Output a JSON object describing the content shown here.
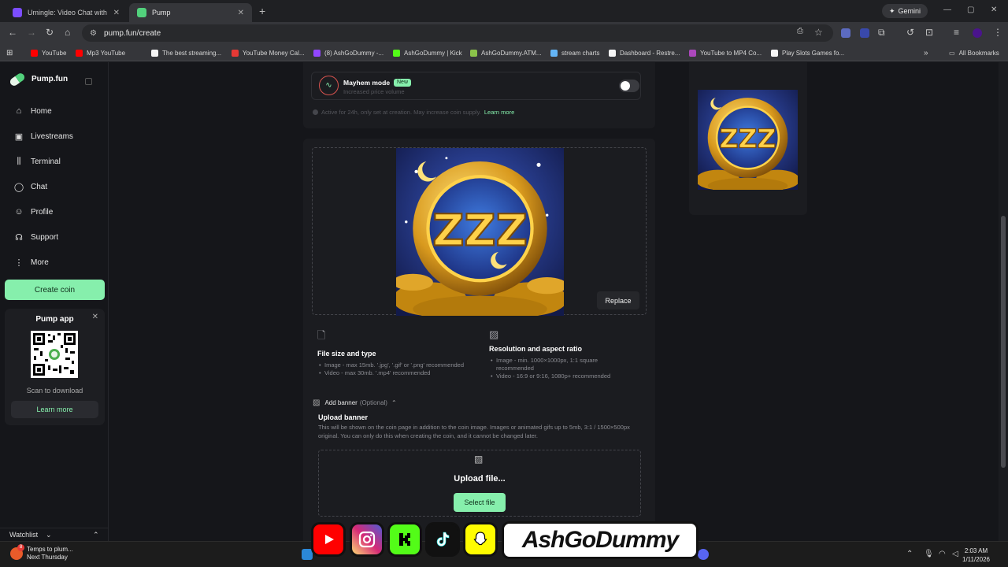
{
  "browser": {
    "tabs": [
      {
        "title": "Umingle: Video Chat with Stra",
        "favicon_color": "#7c4dff"
      },
      {
        "title": "Pump",
        "favicon_color": "#52d17c"
      }
    ],
    "gemini_label": "Gemini",
    "url": "pump.fun/create",
    "bookmarks": [
      {
        "label": "YouTube",
        "color": "#ff0000"
      },
      {
        "label": "Mp3 YouTube",
        "color": "#ff0000"
      },
      {
        "label": "The best streaming...",
        "color": "#f5f5f5"
      },
      {
        "label": "YouTube Money Cal...",
        "color": "#e53935"
      },
      {
        "label": "(8) AshGoDummy -...",
        "color": "#9146ff"
      },
      {
        "label": "AshGoDummy | Kick",
        "color": "#53fc18"
      },
      {
        "label": "AshGoDummy.ATM...",
        "color": "#8bc34a"
      },
      {
        "label": "stream charts",
        "color": "#64b5f6"
      },
      {
        "label": "Dashboard - Restre...",
        "color": "#f5f5f5"
      },
      {
        "label": "YouTube to MP4 Co...",
        "color": "#ab47bc"
      },
      {
        "label": "Play Slots Games fo...",
        "color": "#f5f5f5"
      }
    ],
    "all_bookmarks": "All Bookmarks"
  },
  "sidebar": {
    "brand": "Pump.fun",
    "nav": [
      {
        "label": "Home",
        "icon": "home-icon"
      },
      {
        "label": "Livestreams",
        "icon": "video-icon"
      },
      {
        "label": "Terminal",
        "icon": "candles-icon"
      },
      {
        "label": "Chat",
        "icon": "chat-icon"
      },
      {
        "label": "Profile",
        "icon": "profile-icon"
      },
      {
        "label": "Support",
        "icon": "headset-icon"
      },
      {
        "label": "More",
        "icon": "dots-icon"
      }
    ],
    "create_coin": "Create coin",
    "pump_app": {
      "title": "Pump app",
      "scan": "Scan to download",
      "learn_more": "Learn more"
    },
    "watchlist": "Watchlist"
  },
  "mayhem": {
    "title": "Mayhem mode",
    "badge": "New",
    "subtitle": "Increased price volume",
    "note": "Active for 24h, only set at creation. May increase coin supply.",
    "learn_more": "Learn more",
    "enabled": false
  },
  "form": {
    "replace": "Replace",
    "file_size": {
      "title": "File size and type",
      "items": [
        "Image - max 15mb. '.jpg', '.gif' or '.png' recommended",
        "Video - max 30mb. '.mp4' recommended"
      ]
    },
    "resolution": {
      "title": "Resolution and aspect ratio",
      "items": [
        "Image - min. 1000×1000px, 1:1 square recommended",
        "Video - 16:9 or 9:16, 1080p+ recommended"
      ]
    },
    "add_banner": "Add banner",
    "optional": "(Optional)",
    "upload_banner_title": "Upload banner",
    "upload_banner_desc": "This will be shown on the coin page in addition to the coin image. Images or animated gifs up to 5mb, 3:1 / 1500×500px original. You can only do this when creating the coin, and it cannot be changed later.",
    "upload_file": "Upload file...",
    "select_file": "Select file"
  },
  "taskbar": {
    "weather_line1": "Temps to plum...",
    "weather_line2": "Next Thursday",
    "badge": "8",
    "time": "2:03 AM",
    "date": "1/11/2026"
  },
  "overlay": {
    "handle": "AshGoDummy"
  },
  "colors": {
    "accent_green": "#86efac",
    "background": "#15161a",
    "card": "#1b1c20"
  }
}
